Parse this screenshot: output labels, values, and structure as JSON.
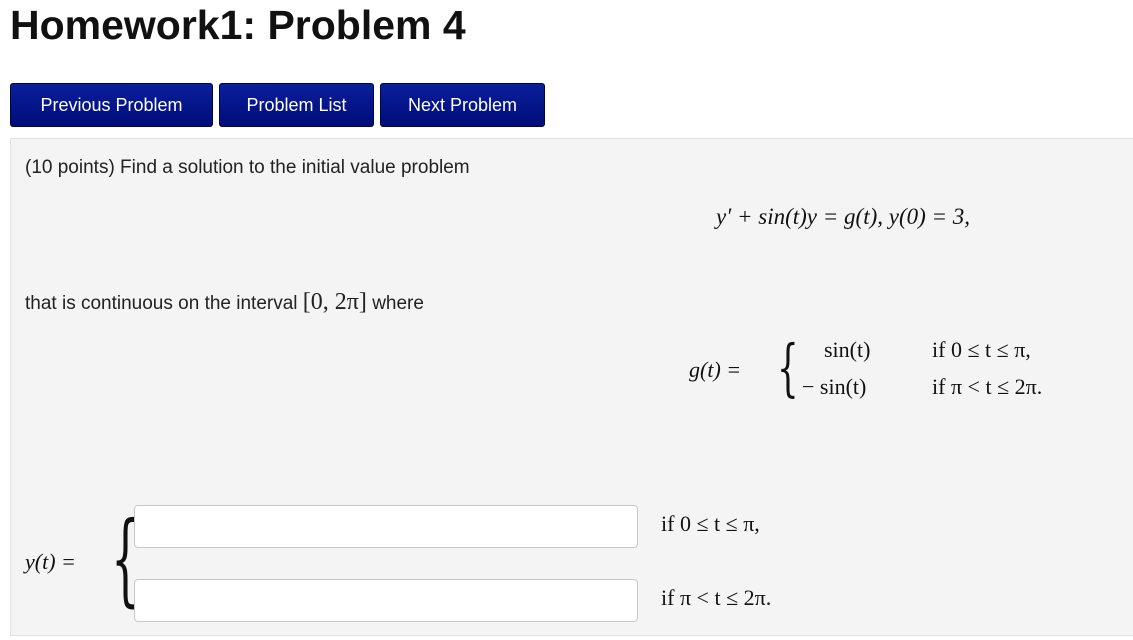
{
  "page": {
    "title": "Homework1: Problem 4"
  },
  "nav": {
    "previous_label": "Previous Problem",
    "list_label": "Problem List",
    "next_label": "Next Problem",
    "button_color": "#0a1f9a"
  },
  "problem": {
    "intro": "(10 points) Find a solution to the initial value problem",
    "ivp": "y′ + sin(t)y = g(t),   y(0) = 3,",
    "continuity_text": "that is continuous on the interval",
    "interval": "[0, 2π]",
    "continuity_suffix": "where",
    "g_lhs": "g(t) =",
    "g_case1_expr": "sin(t)",
    "g_case1_cond": "if 0 ≤ t ≤ π,",
    "g_case2_expr": "− sin(t)",
    "g_case2_cond": "if π < t ≤ 2π.",
    "y_lhs": "y(t) =",
    "answer1_value": "",
    "answer2_value": "",
    "y_case1_cond": "if 0 ≤ t ≤ π,",
    "y_case2_cond": "if π < t ≤ 2π."
  }
}
